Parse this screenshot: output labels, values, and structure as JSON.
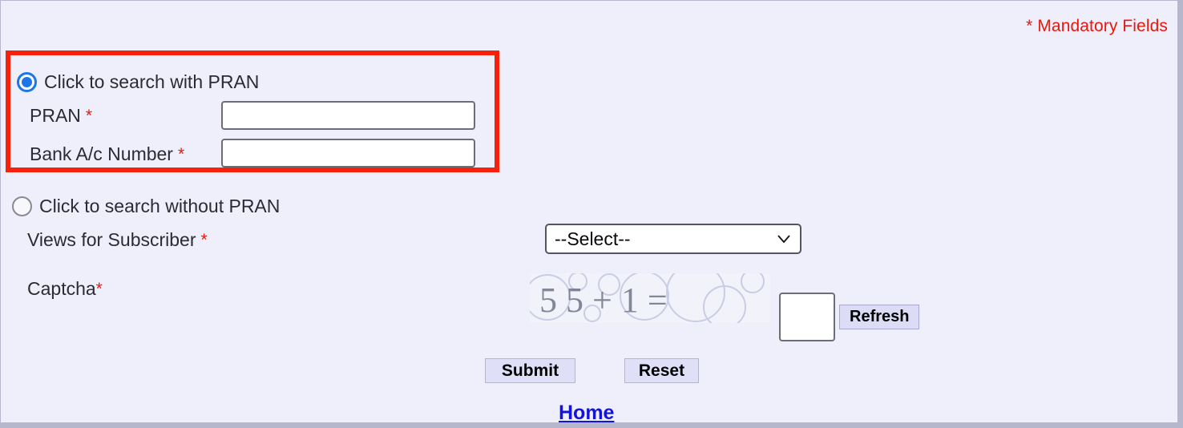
{
  "header": {
    "mandatory_note": "* Mandatory Fields"
  },
  "pran_section": {
    "radio_label": "Click to search with PRAN",
    "radio_selected": true,
    "fields": [
      {
        "label": "PRAN",
        "required_mark": "*",
        "value": "",
        "placeholder": ""
      },
      {
        "label": "Bank A/c Number",
        "required_mark": "*",
        "value": "",
        "placeholder": ""
      }
    ]
  },
  "without_pran_section": {
    "radio_label": "Click to search without PRAN",
    "radio_selected": false
  },
  "views_for_subscriber": {
    "label": "Views for Subscriber",
    "required_mark": "*",
    "selected_option": "--Select--"
  },
  "captcha": {
    "label": "Captcha",
    "required_mark": "*",
    "challenge_text": "5 5 + 1 =",
    "input_value": "",
    "refresh_label": "Refresh"
  },
  "actions": {
    "submit_label": "Submit",
    "reset_label": "Reset",
    "home_label": "Home"
  },
  "colors": {
    "page_background": "#eeeffa",
    "highlight_border": "#f7200a",
    "mandatory_red": "#e8180c",
    "accent_blue": "#1b76e8",
    "link_blue": "#1414d8",
    "button_face": "#dfdff7"
  }
}
